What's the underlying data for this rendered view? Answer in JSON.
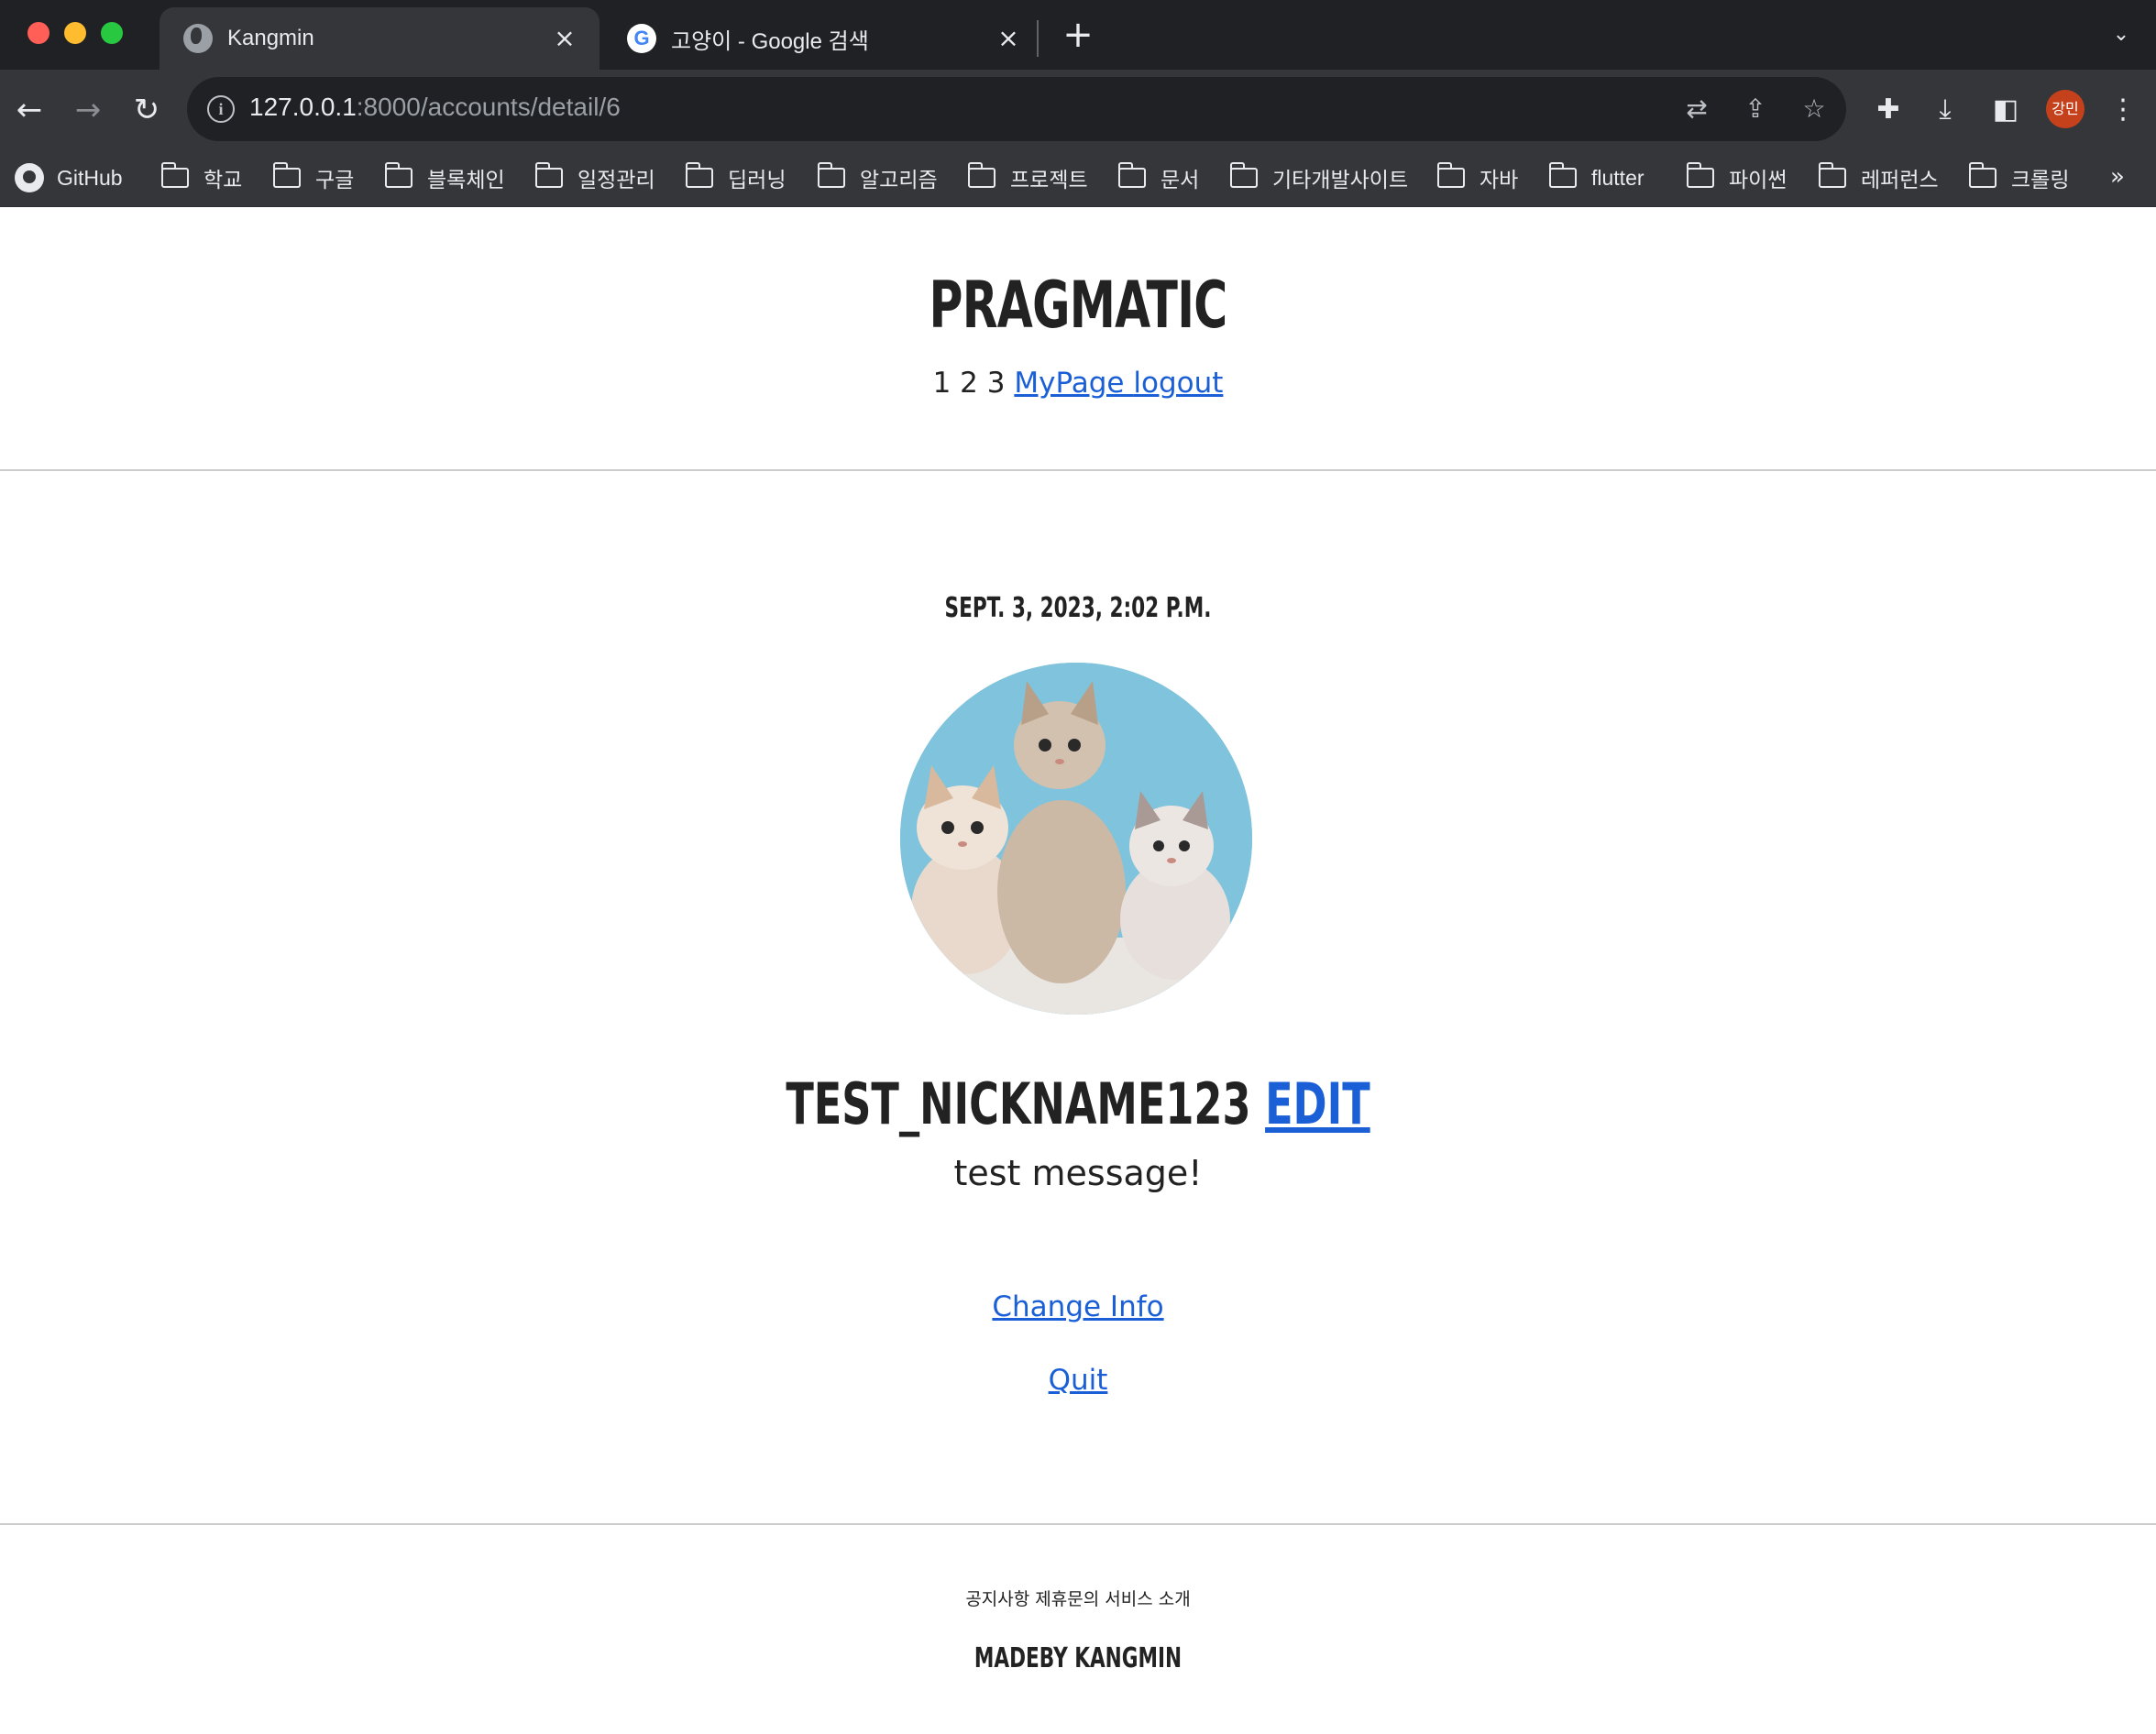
{
  "browser": {
    "tabs": [
      {
        "title": "Kangmin",
        "active": true,
        "icon": "globe-icon"
      },
      {
        "title": "고양이 - Google 검색",
        "active": false,
        "icon": "google-icon"
      }
    ],
    "url_host": "127.0.0.1",
    "url_path": ":8000/accounts/detail/6",
    "profile_label": "강민",
    "bookmarks": [
      "GitHub",
      "학교",
      "구글",
      "블록체인",
      "일정관리",
      "딥러닝",
      "알고리즘",
      "프로젝트",
      "문서",
      "기타개발사이트",
      "자바",
      "flutter",
      "파이썬",
      "레퍼런스",
      "크롤링"
    ],
    "more_label": "»"
  },
  "site": {
    "logo": "Pragmatic",
    "nav_plain": "1 2 3",
    "nav_mypage": "MyPage",
    "nav_logout": "logout"
  },
  "profile": {
    "date": "Sept. 3, 2023, 2:02 p.m.",
    "image_alt": "kittens photo",
    "nickname": "test_nickname123",
    "edit_label": "edit",
    "message": "test message!",
    "change_info": "Change Info",
    "quit": "Quit"
  },
  "footer": {
    "links": "공지사항 제휴문의 서비스 소개",
    "made_by": "MadeBy Kangmin"
  },
  "colors": {
    "link": "#1a5fd6",
    "text": "#222222",
    "chrome_dark": "#202124",
    "chrome_mid": "#35363a"
  }
}
